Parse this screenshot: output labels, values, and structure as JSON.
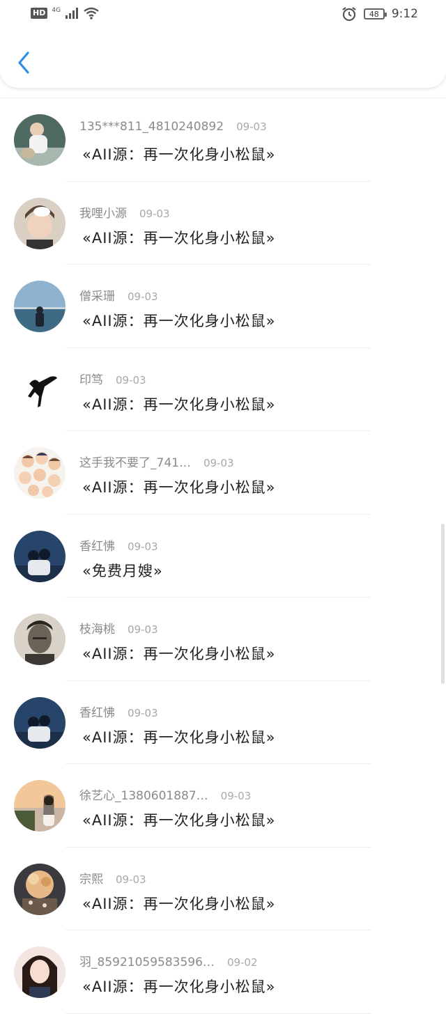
{
  "status_bar": {
    "hd": "HD",
    "network": "4G",
    "battery": "48",
    "time": "9:12"
  },
  "rows": [
    {
      "user": "135***811_4810240892",
      "date": "09-03",
      "title": "«AII源：再一次化身小松鼠»"
    },
    {
      "user": "我哩小源",
      "date": "09-03",
      "title": "«AII源：再一次化身小松鼠»"
    },
    {
      "user": "僧采珊",
      "date": "09-03",
      "title": "«AII源：再一次化身小松鼠»"
    },
    {
      "user": "印笃",
      "date": "09-03",
      "title": "«AII源：再一次化身小松鼠»"
    },
    {
      "user": "这手我不要了_741…",
      "date": "09-03",
      "title": "«AII源：再一次化身小松鼠»"
    },
    {
      "user": "香红怫",
      "date": "09-03",
      "title": "«免费月嫂»"
    },
    {
      "user": "枝海桃",
      "date": "09-03",
      "title": "«AII源：再一次化身小松鼠»"
    },
    {
      "user": "香红怫",
      "date": "09-03",
      "title": "«AII源：再一次化身小松鼠»"
    },
    {
      "user": "徐艺心_1380601887…",
      "date": "09-03",
      "title": "«AII源：再一次化身小松鼠»"
    },
    {
      "user": "宗熙",
      "date": "09-03",
      "title": "«AII源：再一次化身小松鼠»"
    },
    {
      "user": "羽_85921059583596…",
      "date": "09-02",
      "title": "«AII源：再一次化身小松鼠»"
    }
  ],
  "colors": {
    "accent": "#2b8fe6",
    "username": "#8a8a8a",
    "date": "#a8a8a8"
  }
}
